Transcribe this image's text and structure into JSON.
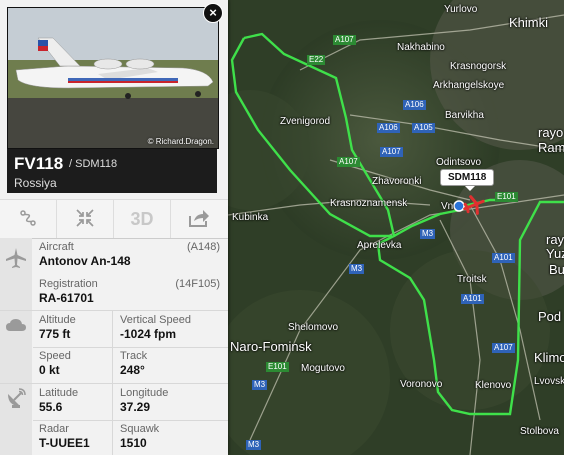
{
  "flight": {
    "callsign": "FV118",
    "flight_number": "/ SDM118",
    "airline": "Rossiya",
    "photo_credit": "© Richard.Dragon.",
    "close_label": "×",
    "aircraft_label": "Aircraft",
    "aircraft_value": "Antonov An-148",
    "aircraft_code": "(A148)",
    "registration_label": "Registration",
    "registration_value": "RA-61701",
    "registration_code": "(14F105)",
    "altitude_label": "Altitude",
    "altitude_value": "775 ft",
    "vspeed_label": "Vertical Speed",
    "vspeed_value": "-1024 fpm",
    "speed_label": "Speed",
    "speed_value": "0 kt",
    "track_label": "Track",
    "track_value": "248°",
    "lat_label": "Latitude",
    "lat_value": "55.6",
    "lon_label": "Longitude",
    "lon_value": "37.29",
    "radar_label": "Radar",
    "radar_value": "T-UUEE1",
    "squawk_label": "Squawk",
    "squawk_value": "1510"
  },
  "toolbar": {
    "route_icon": "route-icon",
    "fullscreen_icon": "compress-icon",
    "view3d_label": "3D",
    "share_icon": "share-icon"
  },
  "map": {
    "plane_label": "SDM118",
    "places": {
      "yurlovo": "Yurlovo",
      "khimki": "Khimki",
      "nakhabino": "Nakhabino",
      "krasnogorsk": "Krasnogorsk",
      "arkhangelskoye": "Arkhangelskoye",
      "zvenigorod": "Zvenigorod",
      "barvikha": "Barvikha",
      "odintsovo": "Odintsovo",
      "rayo1": "rayo",
      "rame": "Rame",
      "zhavoronki": "Zhavoronki",
      "krasnoznamensk": "Krasnoznamensk",
      "vn": "Vn",
      "kubinka": "Kubinka",
      "aprelevka": "Aprelevka",
      "troitsk": "Troitsk",
      "rayo2": "rayo",
      "yuzh": "Yuzh",
      "bu": "Bu",
      "pod": "Pod",
      "shelomovo": "Shelomovo",
      "narofominsk": "Naro-Fominsk",
      "mogutovo": "Mogutovo",
      "klimo": "Klimo",
      "lvovsk": "Lvovsk",
      "voronovo": "Voronovo",
      "klenovo": "Klenovo",
      "stolbova": "Stolbova"
    },
    "roads": {
      "a107_top": "A107",
      "e22": "E22",
      "a106_1": "A106",
      "a106_2": "A106",
      "a105": "A105",
      "a107_left": "A107",
      "a107_mid": "A107",
      "m3_1": "M3",
      "m3_2": "M3",
      "e101_top": "E101",
      "a101_1": "A101",
      "a101_2": "A101",
      "e101_bot": "E101",
      "a107_bot": "A107",
      "m3_3": "M3",
      "m3_4": "M3"
    },
    "track_color": "#3fe04a",
    "plane_color": "#e03030"
  }
}
